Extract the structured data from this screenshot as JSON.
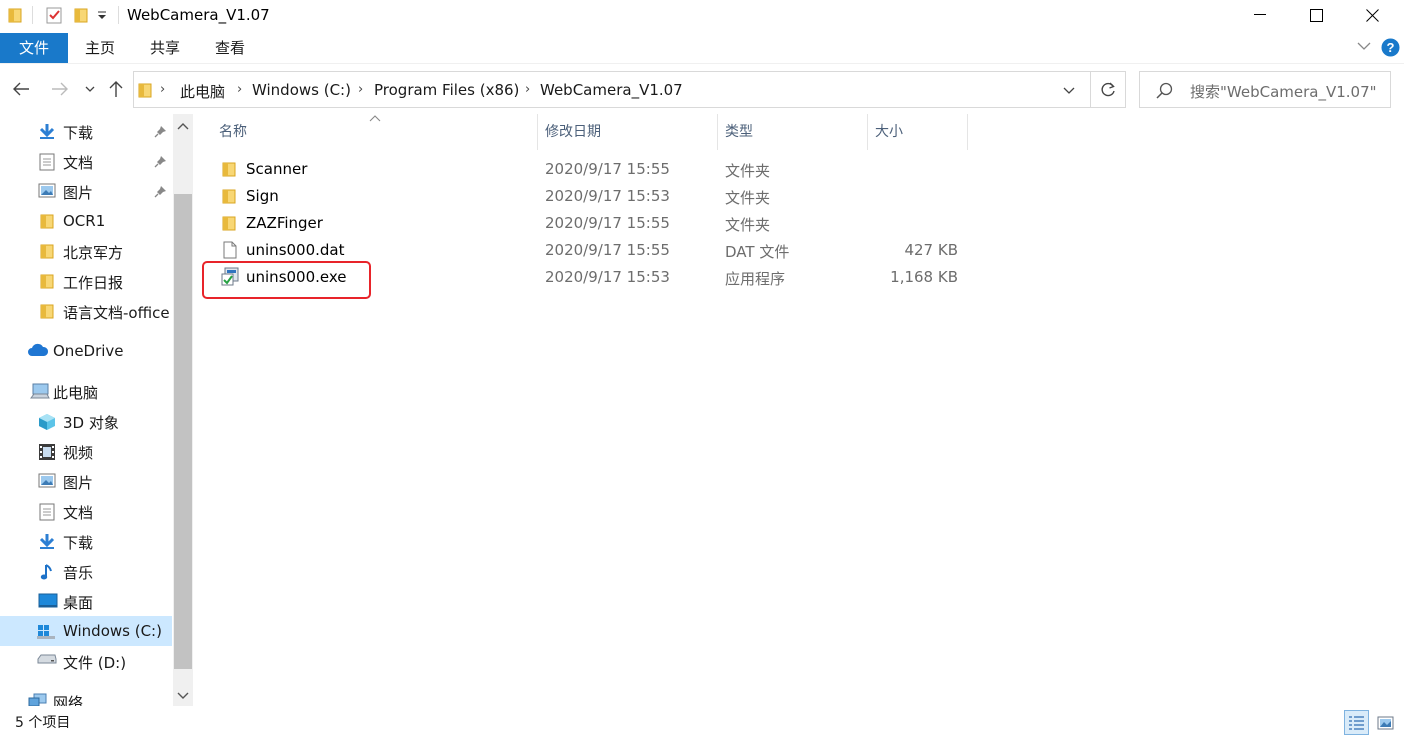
{
  "window": {
    "title": "WebCamera_V1.07",
    "minimize": "minimize",
    "maximize": "maximize",
    "close": "close"
  },
  "ribbon": {
    "tabs": [
      {
        "label": "文件",
        "active": true
      },
      {
        "label": "主页"
      },
      {
        "label": "共享"
      },
      {
        "label": "查看"
      }
    ]
  },
  "address": {
    "crumbs": [
      "此电脑",
      "Windows (C:)",
      "Program Files (x86)",
      "WebCamera_V1.07"
    ],
    "search_placeholder": "搜索\"WebCamera_V1.07\""
  },
  "sidebar": {
    "quick_access": [
      {
        "label": "下载",
        "icon": "download-icon",
        "pinned": true
      },
      {
        "label": "文档",
        "icon": "document-icon",
        "pinned": true
      },
      {
        "label": "图片",
        "icon": "picture-icon",
        "pinned": true
      },
      {
        "label": "OCR1",
        "icon": "folder-icon"
      },
      {
        "label": "北京军方",
        "icon": "folder-icon"
      },
      {
        "label": "工作日报",
        "icon": "folder-icon"
      },
      {
        "label": "语言文档-office",
        "icon": "folder-icon"
      }
    ],
    "onedrive": "OneDrive",
    "this_pc": "此电脑",
    "pc_items": [
      {
        "label": "3D 对象",
        "icon": "3d-objects-icon"
      },
      {
        "label": "视频",
        "icon": "video-icon"
      },
      {
        "label": "图片",
        "icon": "picture-icon"
      },
      {
        "label": "文档",
        "icon": "document-icon"
      },
      {
        "label": "下载",
        "icon": "download-icon"
      },
      {
        "label": "音乐",
        "icon": "music-icon"
      },
      {
        "label": "桌面",
        "icon": "desktop-icon"
      },
      {
        "label": "Windows (C:)",
        "icon": "windows-drive-icon",
        "selected": true
      },
      {
        "label": "文件 (D:)",
        "icon": "drive-icon"
      }
    ],
    "network": "网络"
  },
  "columns": {
    "name": "名称",
    "date": "修改日期",
    "type": "类型",
    "size": "大小"
  },
  "files": [
    {
      "name": "Scanner",
      "date": "2020/9/17 15:55",
      "type": "文件夹",
      "size": "",
      "icon": "folder-icon"
    },
    {
      "name": "Sign",
      "date": "2020/9/17 15:53",
      "type": "文件夹",
      "size": "",
      "icon": "folder-icon"
    },
    {
      "name": "ZAZFinger",
      "date": "2020/9/17 15:55",
      "type": "文件夹",
      "size": "",
      "icon": "folder-icon"
    },
    {
      "name": "unins000.dat",
      "date": "2020/9/17 15:55",
      "type": "DAT 文件",
      "size": "427 KB",
      "icon": "file-icon"
    },
    {
      "name": "unins000.exe",
      "date": "2020/9/17 15:53",
      "type": "应用程序",
      "size": "1,168 KB",
      "icon": "uninstaller-icon",
      "highlighted": true
    }
  ],
  "status": {
    "item_count": "5 个项目"
  },
  "colors": {
    "accent": "#1979ca",
    "selection": "#cce8ff",
    "highlight_box": "#e8242a",
    "folder": "#f8d775"
  }
}
